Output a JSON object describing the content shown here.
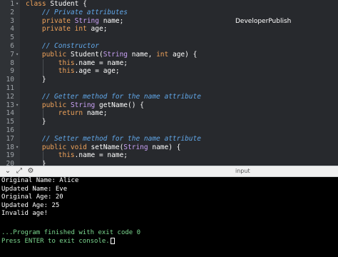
{
  "editor": {
    "watermark": "DeveloperPublish",
    "lines": [
      {
        "n": "1",
        "fold": "▾",
        "tokens": [
          [
            "kw",
            "class "
          ],
          [
            "p",
            "Student {"
          ]
        ]
      },
      {
        "n": "2",
        "fold": "",
        "tokens": [
          [
            "p",
            "    "
          ],
          [
            "cm",
            "// Private attributes"
          ]
        ]
      },
      {
        "n": "3",
        "fold": "",
        "tokens": [
          [
            "p",
            "    "
          ],
          [
            "kw",
            "private "
          ],
          [
            "ty",
            "String "
          ],
          [
            "p",
            "name;"
          ]
        ]
      },
      {
        "n": "4",
        "fold": "",
        "tokens": [
          [
            "p",
            "    "
          ],
          [
            "kw",
            "private int "
          ],
          [
            "p",
            "age;"
          ]
        ]
      },
      {
        "n": "5",
        "fold": "",
        "tokens": []
      },
      {
        "n": "6",
        "fold": "",
        "tokens": [
          [
            "p",
            "    "
          ],
          [
            "cm",
            "// Constructor"
          ]
        ]
      },
      {
        "n": "7",
        "fold": "▾",
        "tokens": [
          [
            "p",
            "    "
          ],
          [
            "kw",
            "public "
          ],
          [
            "p",
            "Student("
          ],
          [
            "ty",
            "String "
          ],
          [
            "p",
            "name, "
          ],
          [
            "kw",
            "int "
          ],
          [
            "p",
            "age) {"
          ]
        ]
      },
      {
        "n": "8",
        "fold": "",
        "tokens": [
          [
            "p",
            "        "
          ],
          [
            "kw",
            "this"
          ],
          [
            "p",
            ".name = name;"
          ]
        ]
      },
      {
        "n": "9",
        "fold": "",
        "tokens": [
          [
            "p",
            "        "
          ],
          [
            "kw",
            "this"
          ],
          [
            "p",
            ".age = age;"
          ]
        ]
      },
      {
        "n": "10",
        "fold": "",
        "tokens": [
          [
            "p",
            "    }"
          ]
        ]
      },
      {
        "n": "11",
        "fold": "",
        "tokens": []
      },
      {
        "n": "12",
        "fold": "",
        "tokens": [
          [
            "p",
            "    "
          ],
          [
            "cm",
            "// Getter method for the name attribute"
          ]
        ]
      },
      {
        "n": "13",
        "fold": "▾",
        "tokens": [
          [
            "p",
            "    "
          ],
          [
            "kw",
            "public "
          ],
          [
            "ty",
            "String "
          ],
          [
            "p",
            "getName() {"
          ]
        ]
      },
      {
        "n": "14",
        "fold": "",
        "tokens": [
          [
            "p",
            "        "
          ],
          [
            "kw",
            "return "
          ],
          [
            "p",
            "name;"
          ]
        ]
      },
      {
        "n": "15",
        "fold": "",
        "tokens": [
          [
            "p",
            "    }"
          ]
        ]
      },
      {
        "n": "16",
        "fold": "",
        "tokens": []
      },
      {
        "n": "17",
        "fold": "",
        "tokens": [
          [
            "p",
            "    "
          ],
          [
            "cm",
            "// Setter method for the name attribute"
          ]
        ]
      },
      {
        "n": "18",
        "fold": "▾",
        "tokens": [
          [
            "p",
            "    "
          ],
          [
            "kw",
            "public void "
          ],
          [
            "p",
            "setName("
          ],
          [
            "ty",
            "String "
          ],
          [
            "p",
            "name) {"
          ]
        ]
      },
      {
        "n": "19",
        "fold": "",
        "tokens": [
          [
            "p",
            "        "
          ],
          [
            "kw",
            "this"
          ],
          [
            "p",
            ".name = name;"
          ]
        ]
      },
      {
        "n": "20",
        "fold": "",
        "tokens": [
          [
            "p",
            "    }"
          ]
        ]
      }
    ]
  },
  "toolbar": {
    "label": "input",
    "icons": [
      "chevron-down",
      "expand",
      "settings"
    ]
  },
  "console": {
    "output": [
      "Original Name: Alice",
      "Updated Name: Eve",
      "Original Age: 20",
      "Updated Age: 25",
      "Invalid age!"
    ],
    "finished": "...Program finished with exit code 0",
    "prompt": "Press ENTER to exit console."
  },
  "colors": {
    "keyword": "#f0a35a",
    "comment": "#61a8ea",
    "type": "#c9a1f5",
    "success": "#7bd88f"
  }
}
